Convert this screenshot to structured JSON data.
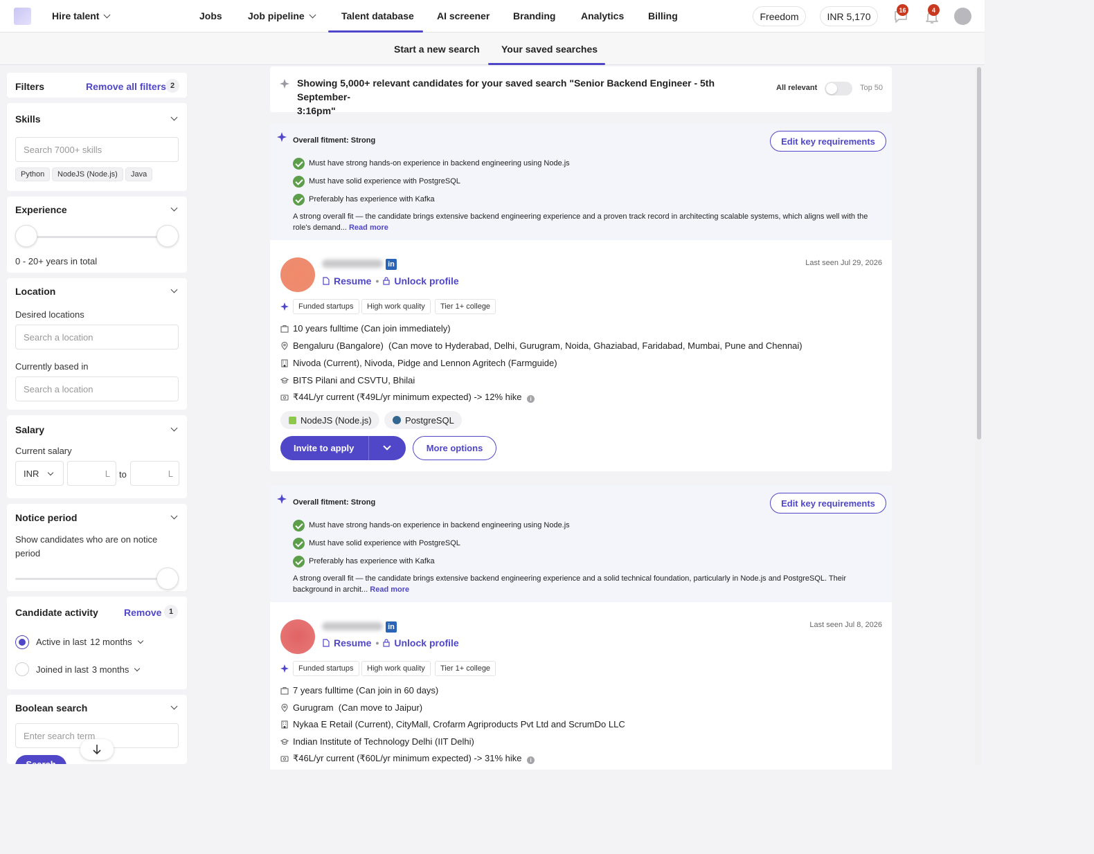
{
  "nav": {
    "hire_label": "Hire talent",
    "links": [
      "Jobs",
      "Job pipeline",
      "Talent database",
      "AI screener",
      "Branding",
      "Analytics",
      "Billing"
    ],
    "plan": "Freedom",
    "balance": "INR 5,170",
    "messages_count": "16",
    "notifications_count": "4",
    "accent_color": "#4f46c8"
  },
  "subtabs": [
    "Start a new search",
    "Your saved searches"
  ],
  "filters": {
    "title": "Filters",
    "remove_all": "Remove all filters",
    "active_count": "2",
    "skills": {
      "title": "Skills",
      "placeholder": "Search 7000+ skills",
      "chips": [
        "Python",
        "NodeJS (Node.js)",
        "Java"
      ]
    },
    "experience": {
      "title": "Experience",
      "summary": "0 - 20+ years in total"
    },
    "location": {
      "title": "Location",
      "desired_label": "Desired locations",
      "desired_placeholder": "Search a location",
      "current_label": "Currently based in",
      "current_placeholder": "Search a location"
    },
    "salary": {
      "title": "Salary",
      "current_label": "Current salary",
      "currency": "INR",
      "unit": "L",
      "to": "to"
    },
    "notice": {
      "title": "Notice period",
      "label": "Show candidates who are on notice period"
    },
    "activity": {
      "title": "Candidate activity",
      "remove": "Remove",
      "count": "1",
      "option1_prefix": "Active in last",
      "option1_value": "12 months",
      "option2_prefix": "Joined in last",
      "option2_value": "3 months"
    },
    "boolean": {
      "title": "Boolean search",
      "placeholder": "Enter search term",
      "button": "Search"
    }
  },
  "banner": {
    "line1": "Showing 5,000+ relevant candidates for your saved search \"Senior Backend Engineer - 5th September-",
    "line2": "3:16pm\"",
    "all_relevant": "All relevant",
    "top50": "Top 50"
  },
  "candidates": [
    {
      "fitment": "Overall fitment: Strong",
      "edit_label": "Edit key requirements",
      "requirements": [
        "Must have strong hands-on experience in backend engineering using Node.js",
        "Must have solid experience with PostgreSQL",
        "Preferably has experience with Kafka"
      ],
      "summary_line1": "A strong overall fit — the candidate brings extensive backend engineering experience and a proven track record in architecting scalable systems, which aligns well with the",
      "summary_line2": "role's demand...",
      "read_more": "Read more",
      "resume": "Resume",
      "unlock": "Unlock profile",
      "last_seen": "Last seen Jul 29, 2026",
      "tags": [
        "Funded startups",
        "High work quality",
        "Tier 1+ college"
      ],
      "experience": "10 years fulltime (Can join immediately)",
      "location": "Bengaluru (Bangalore)  (Can move to Hyderabad, Delhi, Gurugram, Noida, Ghaziabad, Faridabad, Mumbai, Pune and Chennai)",
      "companies": "Nivoda (Current), Nivoda, Pidge and Lennon Agritech (Farmguide)",
      "education": "BITS Pilani and CSVTU, Bhilai",
      "salary": "₹44L/yr current (₹49L/yr minimum expected) -> 12% hike",
      "skills": [
        "NodeJS (Node.js)",
        "PostgreSQL"
      ],
      "invite": "Invite to apply",
      "more": "More options"
    },
    {
      "fitment": "Overall fitment: Strong",
      "edit_label": "Edit key requirements",
      "requirements": [
        "Must have strong hands-on experience in backend engineering using Node.js",
        "Must have solid experience with PostgreSQL",
        "Preferably has experience with Kafka"
      ],
      "summary_line1": "A strong overall fit — the candidate brings extensive backend engineering experience and a solid technical foundation, particularly in Node.js and PostgreSQL. Their",
      "summary_line2": "background in archit...",
      "read_more": "Read more",
      "resume": "Resume",
      "unlock": "Unlock profile",
      "last_seen": "Last seen Jul 8, 2026",
      "tags": [
        "Funded startups",
        "High work quality",
        "Tier 1+ college"
      ],
      "experience": "7 years fulltime (Can join in 60 days)",
      "location": "Gurugram  (Can move to Jaipur)",
      "companies": "Nykaa E Retail (Current), CityMall, Crofarm Agriproducts Pvt Ltd and ScrumDo LLC",
      "education": "Indian Institute of Technology Delhi (IIT Delhi)",
      "salary": "₹46L/yr current (₹60L/yr minimum expected) -> 31% hike"
    }
  ]
}
